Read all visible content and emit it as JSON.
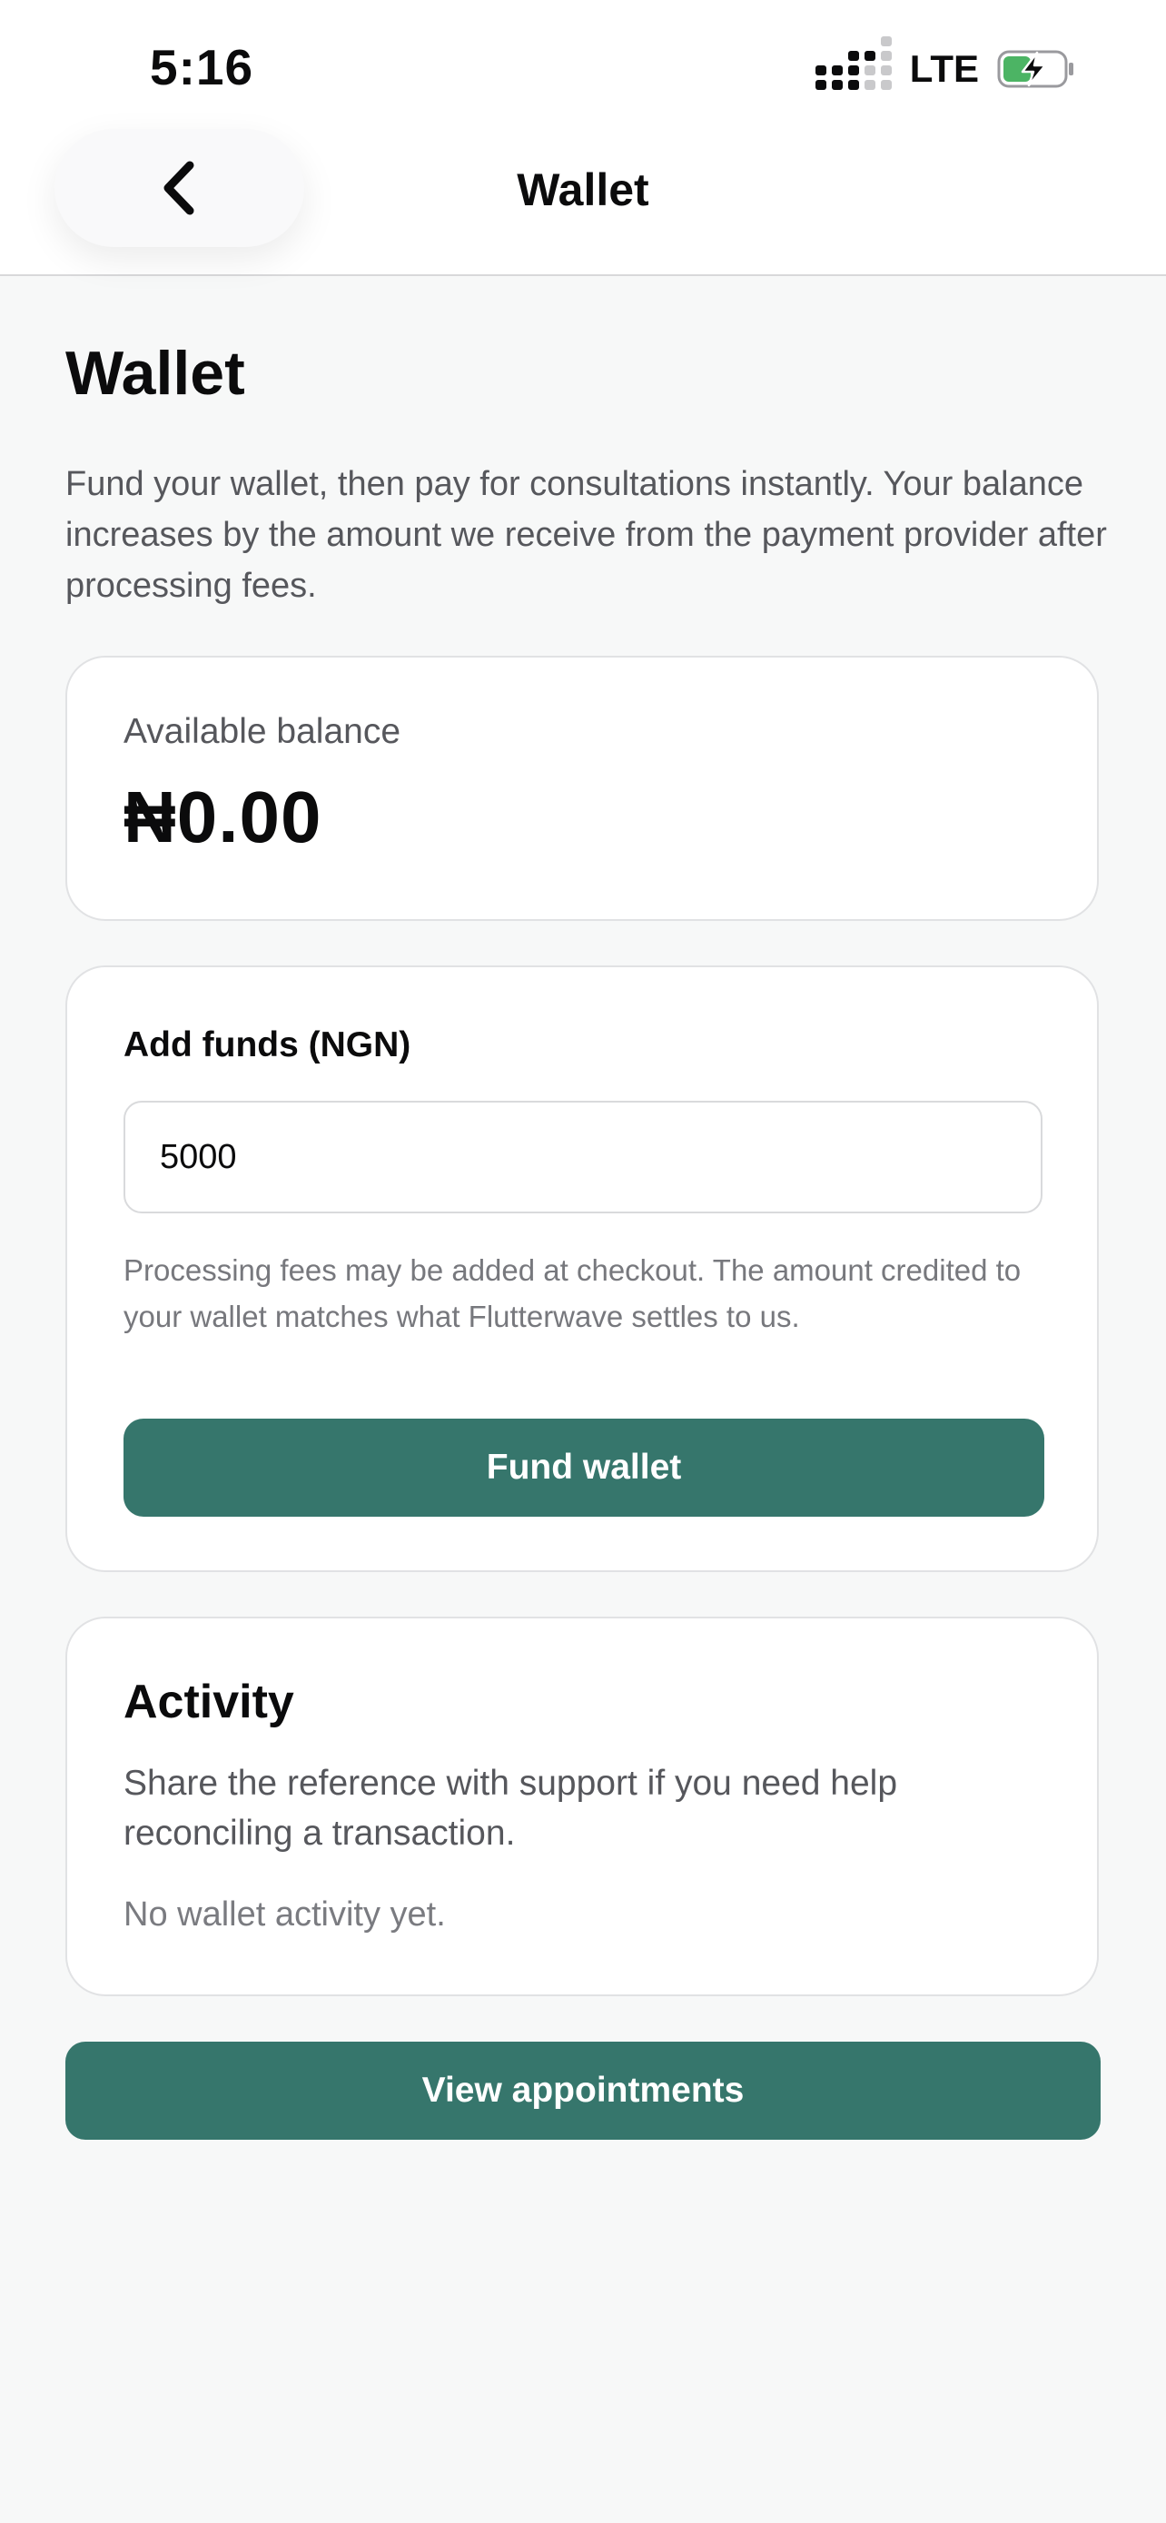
{
  "status_bar": {
    "time": "5:16",
    "network": "LTE"
  },
  "nav": {
    "title": "Wallet"
  },
  "page": {
    "title": "Wallet",
    "intro": "Fund your wallet, then pay for consultations instantly. Your balance increases by the amount we receive from the payment provider after processing fees."
  },
  "balance": {
    "label": "Available balance",
    "value": "₦0.00"
  },
  "add_funds": {
    "label": "Add funds (NGN)",
    "amount_value": "5000",
    "note": "Processing fees may be added at checkout. The amount credited to your wallet matches what Flutterwave settles to us.",
    "button_label": "Fund wallet"
  },
  "activity": {
    "title": "Activity",
    "description": "Share the reference with support if you need help reconciling a transaction.",
    "empty_text": "No wallet activity yet."
  },
  "footer": {
    "appointments_button_label": "View appointments"
  },
  "colors": {
    "accent": "#36766c",
    "background": "#f7f8f8",
    "card": "#ffffff",
    "battery_fill": "#4cb464"
  },
  "icons": {
    "back": "chevron-left-icon",
    "signal": "cellular-signal-icon",
    "battery": "battery-charging-icon"
  }
}
